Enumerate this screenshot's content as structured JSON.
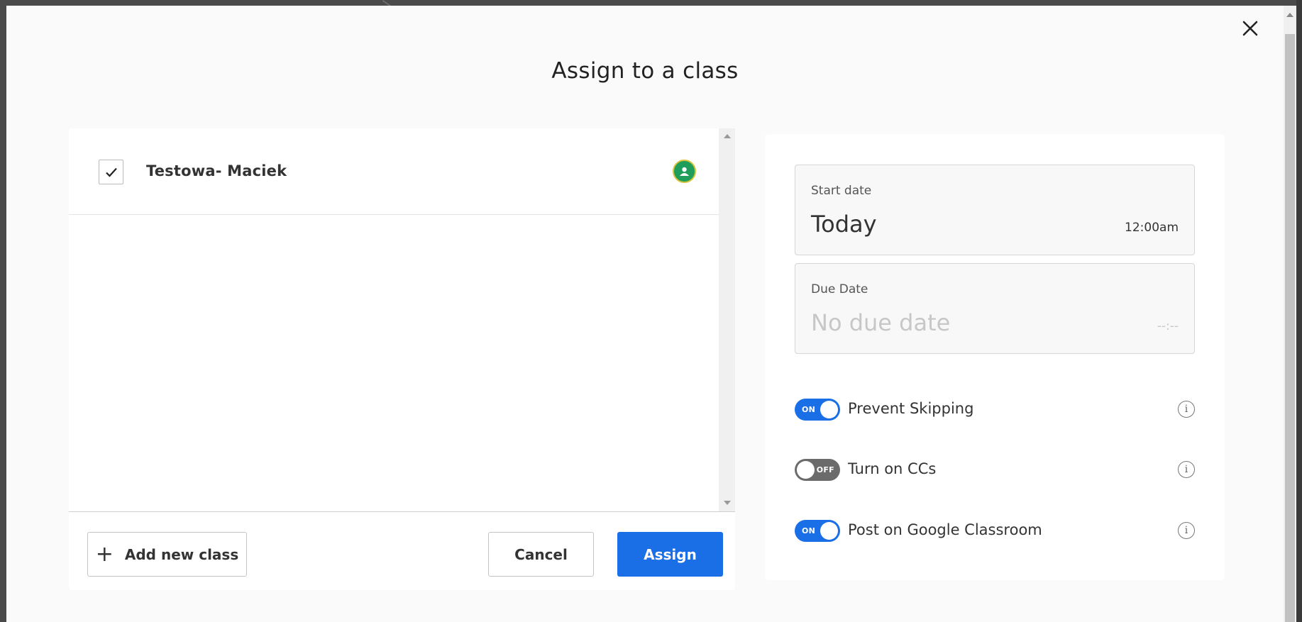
{
  "modal": {
    "title": "Assign to a class",
    "close_icon": "close-icon"
  },
  "classes": [
    {
      "name": "Testowa- Maciek",
      "checked": true,
      "badge_icon": "google-classroom-icon"
    }
  ],
  "footer": {
    "add_class_label": "Add new class",
    "cancel_label": "Cancel",
    "assign_label": "Assign"
  },
  "dates": {
    "start": {
      "label": "Start date",
      "value": "Today",
      "time": "12:00am"
    },
    "due": {
      "label": "Due Date",
      "value": "No due date",
      "time": "--:--"
    }
  },
  "settings": [
    {
      "state": "ON",
      "label": "Prevent Skipping",
      "enabled": true
    },
    {
      "state": "OFF",
      "label": "Turn on CCs",
      "enabled": false
    },
    {
      "state": "ON",
      "label": "Post on Google Classroom",
      "enabled": true
    }
  ],
  "colors": {
    "accent": "#1a6fe6",
    "toggle_off": "#6b6b6b",
    "classroom_green": "#1e9e5a"
  }
}
